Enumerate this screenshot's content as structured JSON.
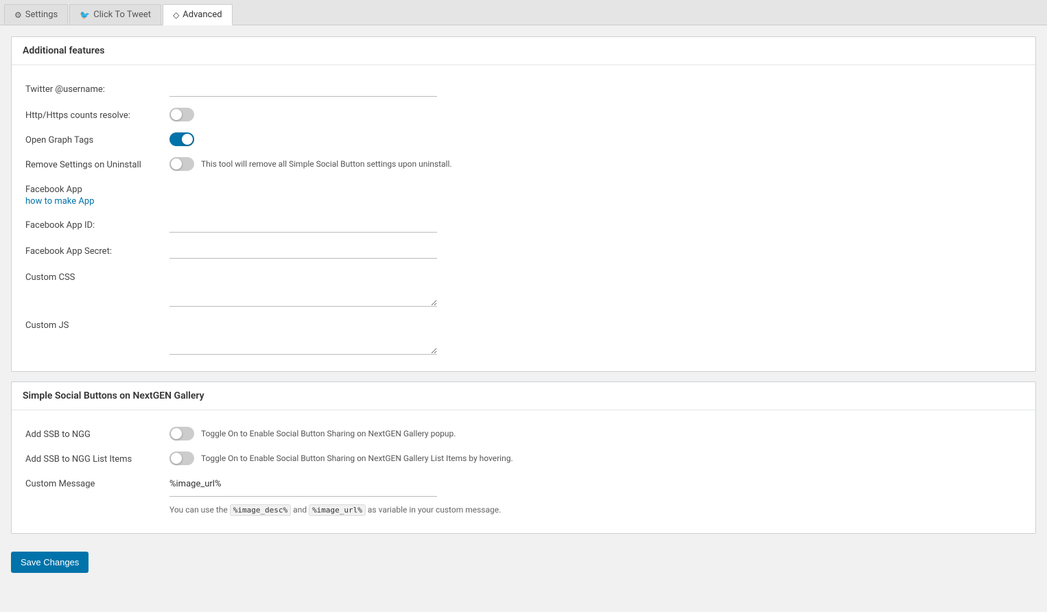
{
  "tabs": [
    {
      "id": "settings",
      "label": "Settings",
      "icon": "⚙",
      "active": false
    },
    {
      "id": "click-to-tweet",
      "label": "Click To Tweet",
      "icon": "🐦",
      "active": false
    },
    {
      "id": "advanced",
      "label": "Advanced",
      "icon": "◇",
      "active": true
    }
  ],
  "additional_features": {
    "title": "Additional features",
    "fields": {
      "twitter_username_label": "Twitter @username:",
      "twitter_username_value": "",
      "http_counts_label": "Http/Https counts resolve:",
      "http_counts_on": false,
      "open_graph_label": "Open Graph Tags",
      "open_graph_on": true,
      "remove_settings_label": "Remove Settings on Uninstall",
      "remove_settings_on": false,
      "remove_settings_desc": "This tool will remove all Simple Social Button settings upon uninstall.",
      "facebook_app_label": "Facebook App",
      "facebook_app_link_text": "how to make App",
      "facebook_app_id_label": "Facebook App ID:",
      "facebook_app_id_value": "",
      "facebook_app_secret_label": "Facebook App Secret:",
      "facebook_app_secret_value": "",
      "custom_css_label": "Custom CSS",
      "custom_css_value": "",
      "custom_js_label": "Custom JS",
      "custom_js_value": ""
    }
  },
  "nextgen_gallery": {
    "title": "Simple Social Buttons on NextGEN Gallery",
    "fields": {
      "add_ssb_ngg_label": "Add SSB to NGG",
      "add_ssb_ngg_on": false,
      "add_ssb_ngg_desc": "Toggle On to Enable Social Button Sharing on NextGEN Gallery popup.",
      "add_ssb_ngg_list_label": "Add SSB to NGG List Items",
      "add_ssb_ngg_list_on": false,
      "add_ssb_ngg_list_desc": "Toggle On to Enable Social Button Sharing on NextGEN Gallery List Items by hovering.",
      "custom_message_label": "Custom Message",
      "custom_message_value": "%image_url%",
      "help_text_1": "You can use the ",
      "help_code_1": "%image_desc%",
      "help_text_2": " and ",
      "help_code_2": "%image_url%",
      "help_text_3": " as variable in your custom message."
    }
  },
  "footer": {
    "save_button_label": "Save Changes"
  }
}
